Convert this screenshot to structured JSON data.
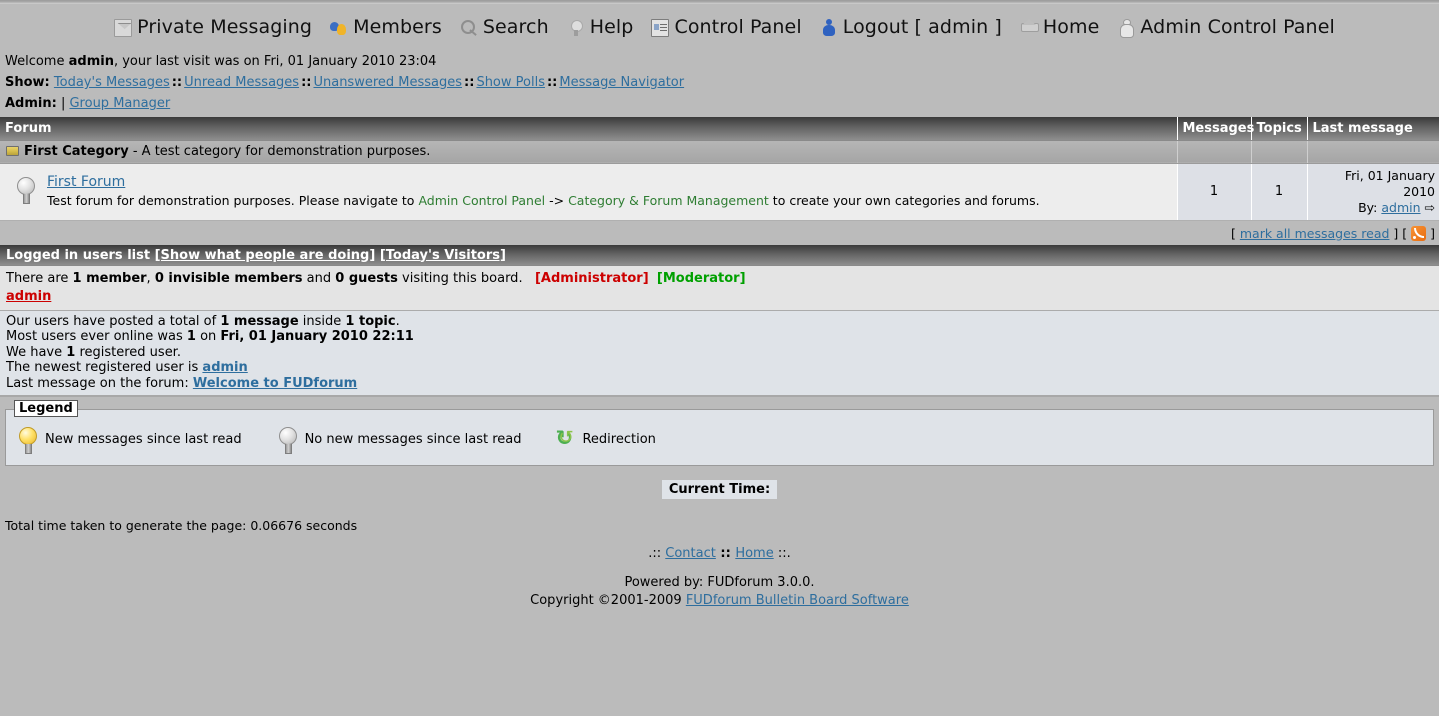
{
  "nav": [
    {
      "icon": "private-messaging-icon",
      "label": "Private Messaging",
      "icon_class": "ico-pm"
    },
    {
      "icon": "members-icon",
      "label": "Members",
      "icon_class": "ico-members"
    },
    {
      "icon": "search-icon",
      "label": "Search",
      "icon_class": "ico-search"
    },
    {
      "icon": "help-icon",
      "label": "Help",
      "icon_class": "ico-bulb-grey"
    },
    {
      "icon": "control-panel-icon",
      "label": "Control Panel",
      "icon_class": "ico-cp"
    },
    {
      "icon": "logout-icon",
      "label": "Logout [ admin ]",
      "icon_class": "ico-logout"
    },
    {
      "icon": "home-icon",
      "label": "Home",
      "icon_class": "ico-home"
    },
    {
      "icon": "admin-control-panel-icon",
      "label": "Admin Control Panel",
      "icon_class": "ico-acp"
    }
  ],
  "welcome": {
    "prefix": "Welcome ",
    "user": "admin",
    "suffix": ", your last visit was on Fri, 01 January 2010 23:04",
    "show_label": "Show:",
    "show_links": [
      "Today's Messages",
      "Unread Messages",
      "Unanswered Messages",
      "Show Polls",
      "Message Navigator"
    ],
    "separator": "::",
    "admin_label": "Admin:",
    "admin_links": [
      "Group Manager"
    ]
  },
  "forum_table": {
    "headers": {
      "forum": "Forum",
      "messages": "Messages",
      "topics": "Topics",
      "last_message": "Last message"
    },
    "category": {
      "name": "First Category",
      "dash": " - ",
      "description": "A test category for demonstration purposes."
    },
    "forums": [
      {
        "name": "First Forum",
        "desc_part1": "Test forum for demonstration purposes. Please navigate to ",
        "desc_link1": "Admin Control Panel",
        "desc_arrow": " -> ",
        "desc_link2": "Category & Forum Management",
        "desc_part2": " to create your own categories and forums.",
        "messages": "1",
        "topics": "1",
        "last_date": "Fri, 01 January 2010",
        "last_by_label": "By: ",
        "last_by_user": "admin"
      }
    ]
  },
  "markread": {
    "open_bracket": "[ ",
    "link": "mark all messages read",
    "mid": " ] [ ",
    "close_bracket": " ]"
  },
  "logged_in": {
    "title": "Logged in users list ",
    "link1": "[Show what people are doing]",
    "spacer": " ",
    "link2": "[Today's Visitors]",
    "text_a": "There are ",
    "count_members": "1 member",
    "text_b": ", ",
    "count_invisible": "0 invisible members",
    "text_c": " and ",
    "count_guests": "0 guests",
    "text_d": " visiting this board.",
    "administrator_badge": "[Administrator]",
    "moderator_badge": "[Moderator]",
    "online_users": [
      "admin"
    ]
  },
  "stats": {
    "line1_a": "Our users have posted a total of ",
    "line1_b": "1 message",
    "line1_c": " inside ",
    "line1_d": "1 topic",
    "line1_e": ".",
    "line2_a": "Most users ever online was ",
    "line2_b": "1",
    "line2_c": " on ",
    "line2_d": "Fri, 01 January 2010 22:11",
    "line3_a": "We have ",
    "line3_b": "1",
    "line3_c": " registered user.",
    "line4_a": "The newest registered user is ",
    "line4_b": "admin",
    "line5_a": "Last message on the forum: ",
    "line5_b": "Welcome to FUDforum"
  },
  "legend": {
    "title": "Legend",
    "items": [
      {
        "icon": "new-messages-bulb-icon",
        "label": "New messages since last read"
      },
      {
        "icon": "no-new-messages-bulb-icon",
        "label": "No new messages since last read"
      },
      {
        "icon": "redirection-icon",
        "label": "Redirection"
      }
    ]
  },
  "current_time": {
    "label": "Current Time:"
  },
  "gen_time": "Total time taken to generate the page: 0.06676 seconds",
  "footer": {
    "left_dots": ".:: ",
    "contact": "Contact",
    "mid_sep": " :: ",
    "home": "Home",
    "right_dots": " ::.",
    "powered_by": "Powered by: FUDforum 3.0.0.",
    "copyright_prefix": "Copyright ©2001-2009 ",
    "copyright_link": "FUDforum Bulletin Board Software"
  },
  "colors": {
    "page_bg": "#bbbbbb",
    "header_bar_dark": "#3a3a3a",
    "link": "#2e6e9e",
    "administrator": "#cc0000",
    "moderator": "#00a000",
    "green_text": "#2e7d32"
  }
}
